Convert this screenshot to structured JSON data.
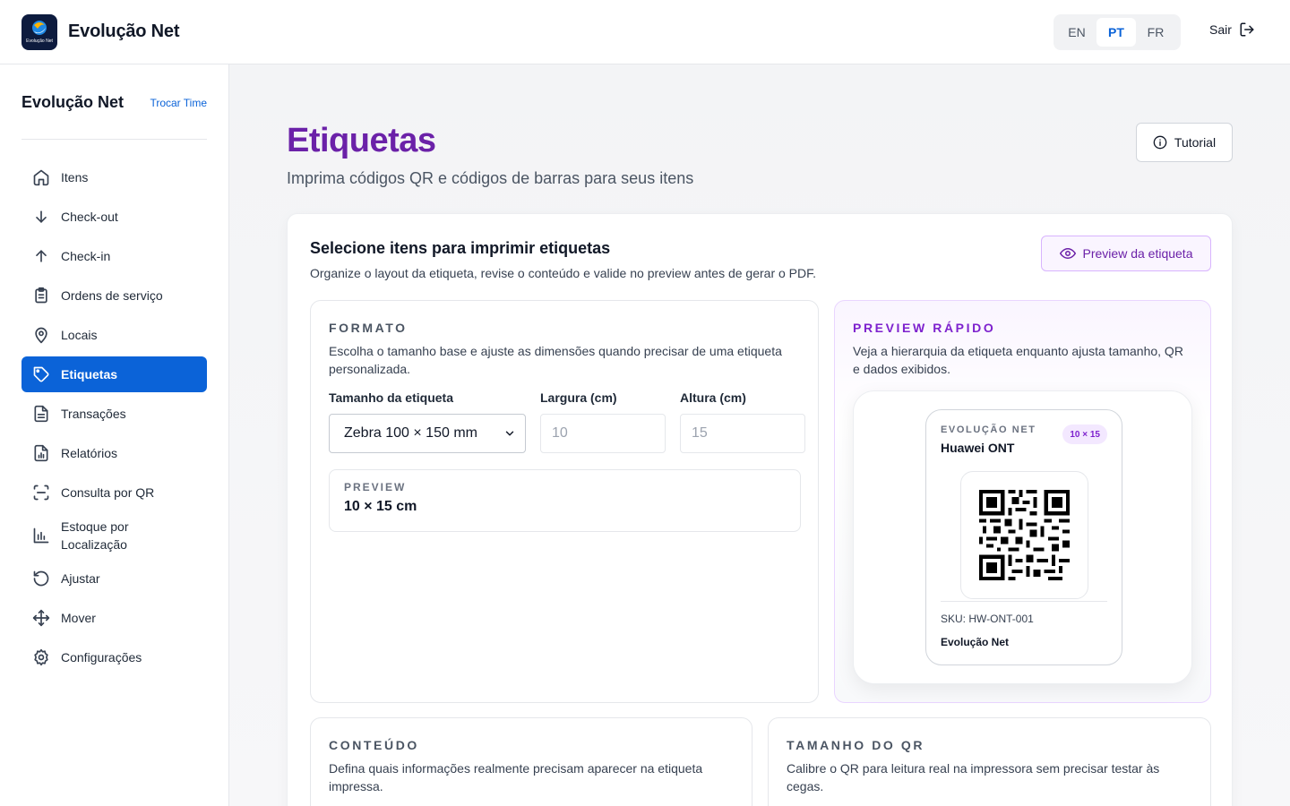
{
  "header": {
    "brand": "Evolução Net",
    "logo_text": "Evolução Net",
    "languages": [
      {
        "code": "EN",
        "active": false
      },
      {
        "code": "PT",
        "active": true
      },
      {
        "code": "FR",
        "active": false
      }
    ],
    "logout_label": "Sair"
  },
  "sidebar": {
    "team_name": "Evolução Net",
    "switch_team_label": "Trocar Time",
    "items": [
      {
        "label": "Itens",
        "icon": "home-icon"
      },
      {
        "label": "Check-out",
        "icon": "arrow-down-icon"
      },
      {
        "label": "Check-in",
        "icon": "arrow-up-icon"
      },
      {
        "label": "Ordens de serviço",
        "icon": "clipboard-icon"
      },
      {
        "label": "Locais",
        "icon": "map-pin-icon"
      },
      {
        "label": "Etiquetas",
        "icon": "tag-icon",
        "active": true
      },
      {
        "label": "Transações",
        "icon": "file-text-icon"
      },
      {
        "label": "Relatórios",
        "icon": "file-chart-icon"
      },
      {
        "label": "Consulta por QR",
        "icon": "scan-icon"
      },
      {
        "label": "Estoque por Localização",
        "icon": "bar-chart-icon"
      },
      {
        "label": "Ajustar",
        "icon": "rotate-ccw-icon"
      },
      {
        "label": "Mover",
        "icon": "move-icon"
      },
      {
        "label": "Configurações",
        "icon": "settings-icon"
      }
    ]
  },
  "page": {
    "title": "Etiquetas",
    "subtitle": "Imprima códigos QR e códigos de barras para seus itens",
    "tutorial_label": "Tutorial"
  },
  "card": {
    "title": "Selecione itens para imprimir etiquetas",
    "description": "Organize o layout da etiqueta, revise o conteúdo e valide no preview antes de gerar o PDF.",
    "preview_button": "Preview da etiqueta"
  },
  "format": {
    "kicker": "FORMATO",
    "description": "Escolha o tamanho base e ajuste as dimensões quando precisar de uma etiqueta personalizada.",
    "size_label": "Tamanho da etiqueta",
    "size_value": "Zebra 100 × 150 mm",
    "width_label": "Largura (cm)",
    "width_value": "10",
    "height_label": "Altura (cm)",
    "height_value": "15",
    "preview_kicker": "PREVIEW",
    "preview_value": "10 × 15 cm"
  },
  "quick_preview": {
    "kicker": "PREVIEW RÁPIDO",
    "description": "Veja a hierarquia da etiqueta enquanto ajusta tamanho, QR e dados exibidos.",
    "label_brand": "EVOLUÇÃO NET",
    "label_badge": "10 × 15",
    "label_item": "Huawei ONT",
    "label_sku": "SKU: HW-ONT-001",
    "label_team": "Evolução Net"
  },
  "content_section": {
    "kicker": "CONTEÚDO",
    "description": "Defina quais informações realmente precisam aparecer na etiqueta impressa."
  },
  "qr_section": {
    "kicker": "TAMANHO DO QR",
    "description": "Calibre o QR para leitura real na impressora sem precisar testar às cegas."
  },
  "colors": {
    "primary": "#0b63d8",
    "accent_purple": "#6b21a8"
  }
}
